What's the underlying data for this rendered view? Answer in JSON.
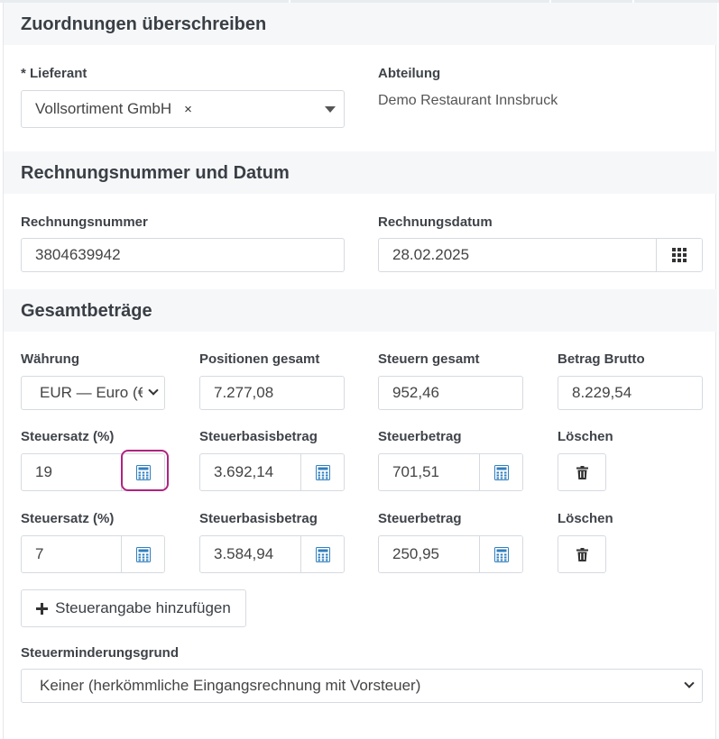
{
  "sections": {
    "assignments": {
      "title": "Zuordnungen überschreiben"
    },
    "invoice": {
      "title": "Rechnungsnummer und Datum"
    },
    "totals": {
      "title": "Gesamtbeträge"
    }
  },
  "assignments": {
    "supplier_label": "* Lieferant",
    "supplier_value": "Vollsortiment GmbH",
    "supplier_clear": "×",
    "department_label": "Abteilung",
    "department_value": "Demo Restaurant Innsbruck"
  },
  "invoice": {
    "number_label": "Rechnungsnummer",
    "number_value": "3804639942",
    "date_label": "Rechnungsdatum",
    "date_value": "28.02.2025"
  },
  "totals": {
    "currency_label": "Währung",
    "currency_value": "EUR — Euro (€",
    "positions_label": "Positionen gesamt",
    "positions_value": "7.277,08",
    "taxes_label": "Steuern gesamt",
    "taxes_value": "952,46",
    "gross_label": "Betrag Brutto",
    "gross_value": "8.229,54"
  },
  "tax_rows": [
    {
      "rate_label": "Steuersatz (%)",
      "rate_value": "19",
      "base_label": "Steuerbasisbetrag",
      "base_value": "3.692,14",
      "amount_label": "Steuerbetrag",
      "amount_value": "701,51",
      "delete_label": "Löschen"
    },
    {
      "rate_label": "Steuersatz (%)",
      "rate_value": "7",
      "base_label": "Steuerbasisbetrag",
      "base_value": "3.584,94",
      "amount_label": "Steuerbetrag",
      "amount_value": "250,95",
      "delete_label": "Löschen"
    }
  ],
  "add_tax": {
    "label": "Steuerangabe hinzufügen"
  },
  "reduction": {
    "label": "Steuerminderungsgrund",
    "value": "Keiner (herkömmliche Eingangsrechnung mit Vorsteuer)"
  },
  "colors": {
    "calc_icon": "#2f7fbf",
    "highlight": "#b0237f",
    "section_bg": "#f6f7f9"
  }
}
